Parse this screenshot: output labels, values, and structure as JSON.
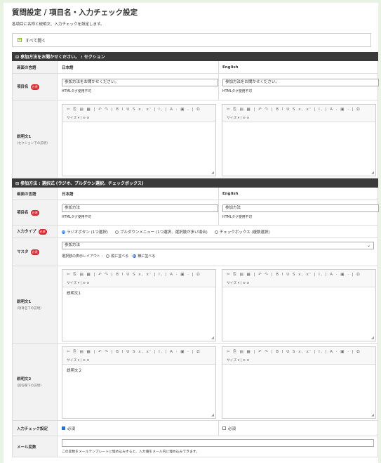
{
  "page": {
    "title": "質問設定 / 項目名・入力チェック設定",
    "description": "各項目に名称と説明文、入力チェックを設定します。",
    "expand_all": "すべて開く"
  },
  "editor": {
    "toolbar_row1": "✂ ⎘ ▤ ▦ | ↶ ↷ | B I U S x, x' | I, | A · ▣ · | Ω",
    "toolbar_row2": "サイズ  ▾ | ⊖ ⊘",
    "grip": "◢"
  },
  "section1": {
    "header": "⊟ 参加方法をお聞かせください。 : セクション",
    "lang_label": "画面の言語",
    "lang_ja": "日本語",
    "lang_en": "English",
    "item_label": "項目名",
    "required_badge": "必須",
    "item_value_ja": "参加方法をお聞かせください。",
    "item_value_en": "参加方法をお聞かせください。",
    "html_note": "HTMLタグ使用不可",
    "desc1_label": "説明文1",
    "desc1_sub": "(セクション下の説明)",
    "desc1_ja": "",
    "desc1_en": ""
  },
  "section2": {
    "header": "⊟ 参加方法 : 選択式 (ラジオ、プルダウン選択、チェックボックス)",
    "lang_label": "画面の言語",
    "lang_ja": "日本語",
    "lang_en": "English",
    "item_label": "項目名",
    "required_badge": "必須",
    "item_value_ja": "参加方法",
    "item_value_en": "参加方法",
    "html_note": "HTMLタグ使用不可",
    "input_type_label": "入力タイプ",
    "input_types": [
      {
        "label": "ラジオボタン (1つ選択)",
        "selected": true
      },
      {
        "label": "プルダウンメニュー (1つ選択、選択肢が多い場合)",
        "selected": false
      },
      {
        "label": "チェックボックス (複数選択)",
        "selected": false
      }
    ],
    "master_label": "マスタ",
    "master_value": "参加方法",
    "layout_label": "選択肢の表示レイアウト :",
    "layout_options": [
      {
        "label": "縦に並べる",
        "selected": false
      },
      {
        "label": "横に並べる",
        "selected": true
      }
    ],
    "desc1_label": "説明文1",
    "desc1_sub": "(項目名下の説明)",
    "desc1_ja": "説明文1",
    "desc1_en": "",
    "desc2_label": "説明文2",
    "desc2_sub": "(回答欄下の説明)",
    "desc2_ja": "説明文２",
    "desc2_en": "",
    "check_label": "入力チェック設定",
    "check_ja": {
      "label": "必須",
      "checked": true
    },
    "check_en": {
      "label": "必須",
      "checked": false
    },
    "mail_label": "メール変数",
    "mail_value": "",
    "mail_note": "この変数をメールテンプレートに埋め込みすると、入力値をメール内に埋め込みできます。"
  }
}
